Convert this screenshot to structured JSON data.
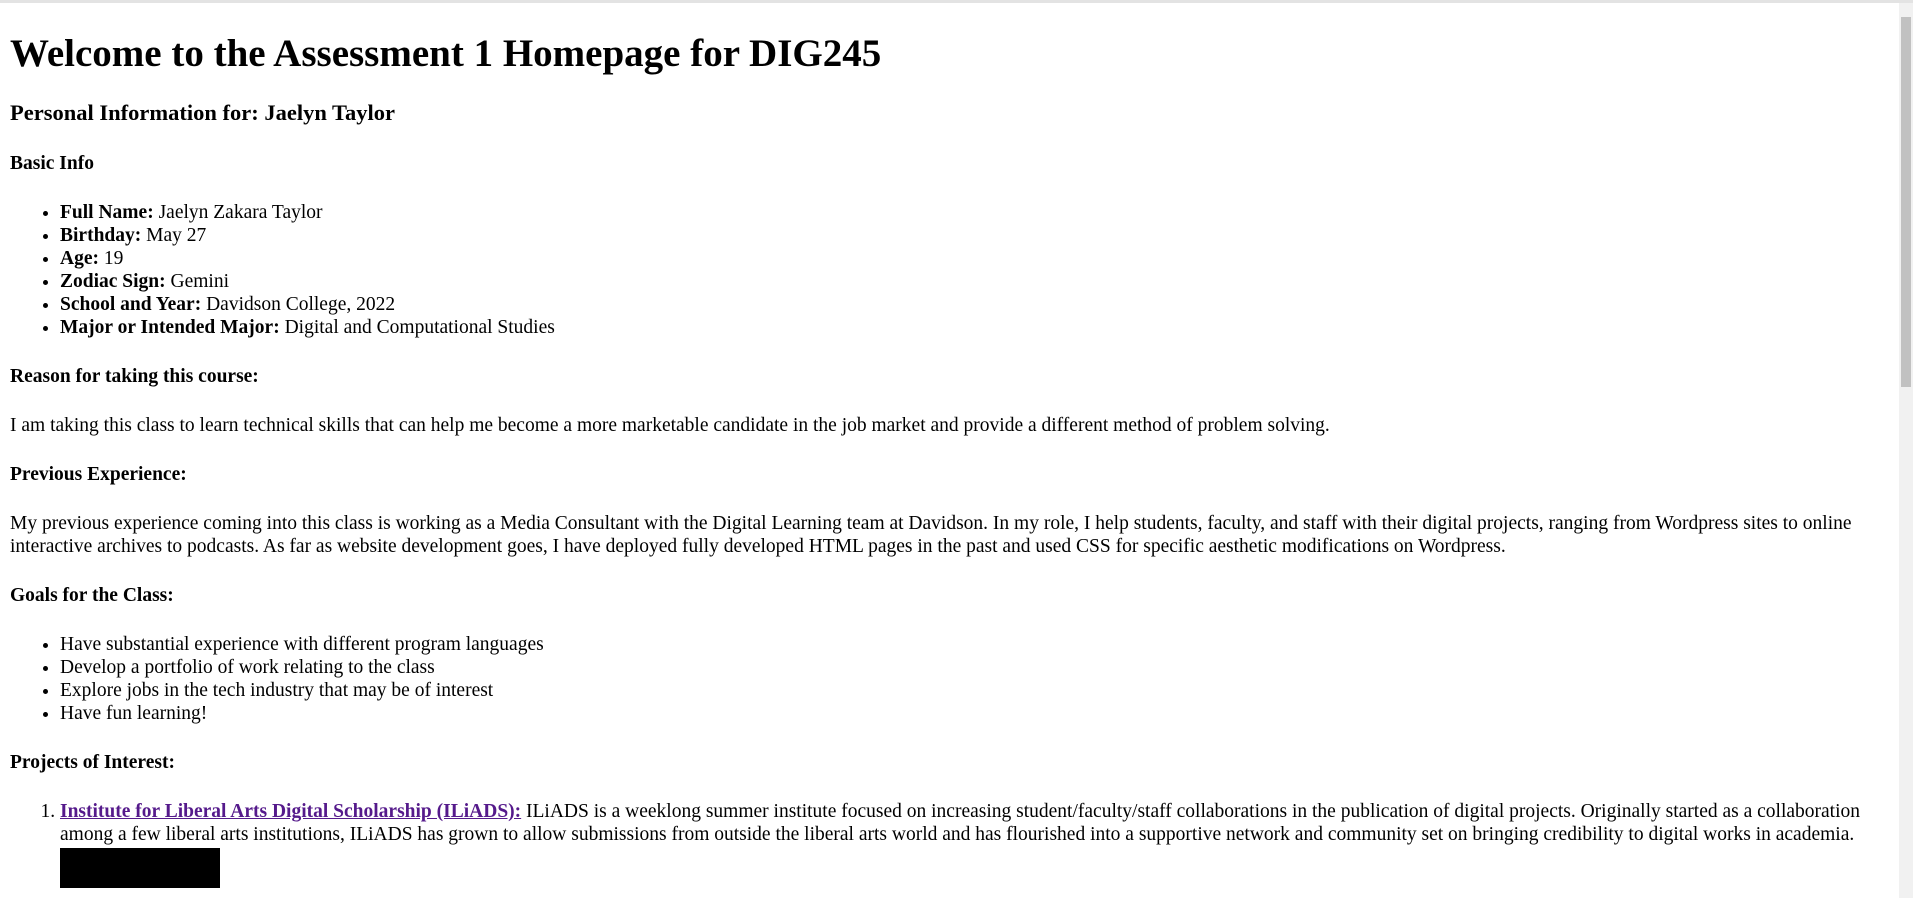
{
  "page": {
    "title": "Welcome to the Assessment 1 Homepage for DIG245",
    "subtitle": "Personal Information for: Jaelyn Taylor"
  },
  "basic_info": {
    "heading": "Basic Info",
    "items": [
      {
        "label": "Full Name:",
        "value": " Jaelyn Zakara Taylor"
      },
      {
        "label": "Birthday:",
        "value": " May 27"
      },
      {
        "label": "Age:",
        "value": " 19"
      },
      {
        "label": "Zodiac Sign:",
        "value": " Gemini"
      },
      {
        "label": "School and Year:",
        "value": " Davidson College, 2022"
      },
      {
        "label": "Major or Intended Major:",
        "value": " Digital and Computational Studies"
      }
    ]
  },
  "reason": {
    "heading": "Reason for taking this course:",
    "text": "I am taking this class to learn technical skills that can help me become a more marketable candidate in the job market and provide a different method of problem solving."
  },
  "experience": {
    "heading": "Previous Experience:",
    "text": "My previous experience coming into this class is working as a Media Consultant with the Digital Learning team at Davidson. In my role, I help students, faculty, and staff with their digital projects, ranging from Wordpress sites to online interactive archives to podcasts. As far as website development goes, I have deployed fully developed HTML pages in the past and used CSS for specific aesthetic modifications on Wordpress."
  },
  "goals": {
    "heading": "Goals for the Class:",
    "items": [
      "Have substantial experience with different program languages",
      "Develop a portfolio of work relating to the class",
      "Explore jobs in the tech industry that may be of interest",
      "Have fun learning!"
    ]
  },
  "projects": {
    "heading": "Projects of Interest:",
    "items": [
      {
        "link_text": "Institute for Liberal Arts Digital Scholarship (ILiADS):",
        "description": " ILiADS is a weeklong summer institute focused on increasing student/faculty/staff collaborations in the publication of digital projects. Originally started as a collaboration among a few liberal arts institutions, ILiADS has grown to allow submissions from outside the liberal arts world and has flourished into a supportive network and community set on bringing credibility to digital works in academia."
      }
    ]
  },
  "colors": {
    "link_visited": "#551a8b",
    "text": "#000000",
    "background": "#ffffff"
  }
}
